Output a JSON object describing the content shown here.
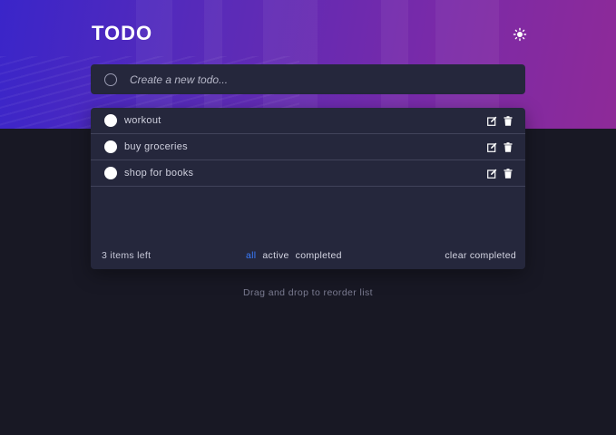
{
  "header": {
    "title": "TODO",
    "theme_icon": "sun-icon"
  },
  "new_todo": {
    "placeholder": "Create a new todo..."
  },
  "todos": [
    {
      "label": "workout",
      "completed": false
    },
    {
      "label": "buy groceries",
      "completed": false
    },
    {
      "label": "shop for books",
      "completed": false
    }
  ],
  "footer": {
    "items_left": "3 items left",
    "filters": {
      "all": "all",
      "active": "active",
      "completed": "completed"
    },
    "selected_filter": "all",
    "clear": "clear completed"
  },
  "hint": "Drag and drop to reorder list",
  "colors": {
    "background": "#181824",
    "card": "#25273c",
    "accent": "#3a7bfd",
    "gradient_start": "#3a25c9",
    "gradient_end": "#8e2a98"
  }
}
